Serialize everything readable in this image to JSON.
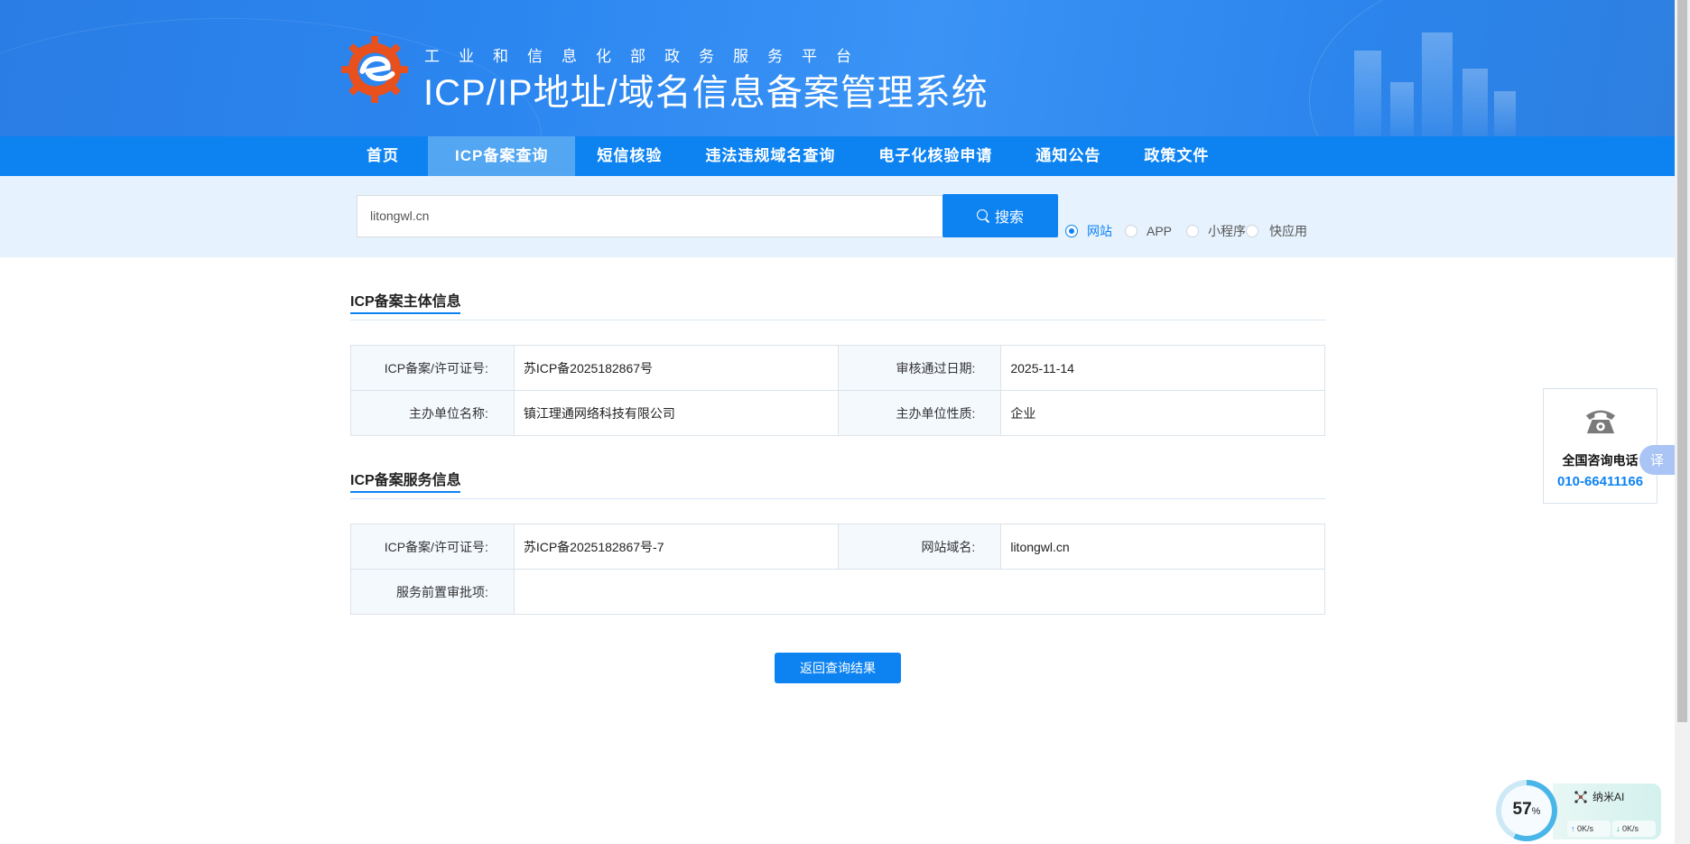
{
  "header": {
    "subtitle": "工业和信息化部政务服务平台",
    "title": "ICP/IP地址/域名信息备案管理系统"
  },
  "nav": {
    "items": [
      "首页",
      "ICP备案查询",
      "短信核验",
      "违法违规域名查询",
      "电子化核验申请",
      "通知公告",
      "政策文件"
    ],
    "active": "ICP备案查询"
  },
  "search": {
    "value": "litongwl.cn",
    "button_label": "搜索",
    "options": [
      "网站",
      "APP",
      "小程序",
      "快应用"
    ],
    "selected": "网站"
  },
  "subject_info": {
    "title": "ICP备案主体信息",
    "rows": [
      {
        "k1": "ICP备案/许可证号:",
        "v1": "苏ICP备2025182867号",
        "k2": "审核通过日期:",
        "v2": "2025-11-14"
      },
      {
        "k1": "主办单位名称:",
        "v1": "镇江理通网络科技有限公司",
        "k2": "主办单位性质:",
        "v2": "企业"
      }
    ]
  },
  "service_info": {
    "title": "ICP备案服务信息",
    "license_label": "ICP备案/许可证号:",
    "license_value": "苏ICP备2025182867号-7",
    "domain_label": "网站域名:",
    "domain_value": "litongwl.cn",
    "approval_label": "服务前置审批项:",
    "approval_value": ""
  },
  "return_button": "返回查询结果",
  "hotline": {
    "label": "全国咨询电话",
    "number": "010-66411166",
    "icon": "phone-icon"
  },
  "translate_label": "译",
  "widget": {
    "percent": 57,
    "percent_text": "57",
    "percent_sign": "%",
    "name": "纳米AI",
    "upload": "0K/s",
    "download": "0K/s",
    "colors": {
      "ring": "#49b5e8"
    }
  },
  "colors": {
    "primary": "#0d83f2",
    "nav_active": "#52a6f2",
    "search_band": "#e6f2fd"
  }
}
